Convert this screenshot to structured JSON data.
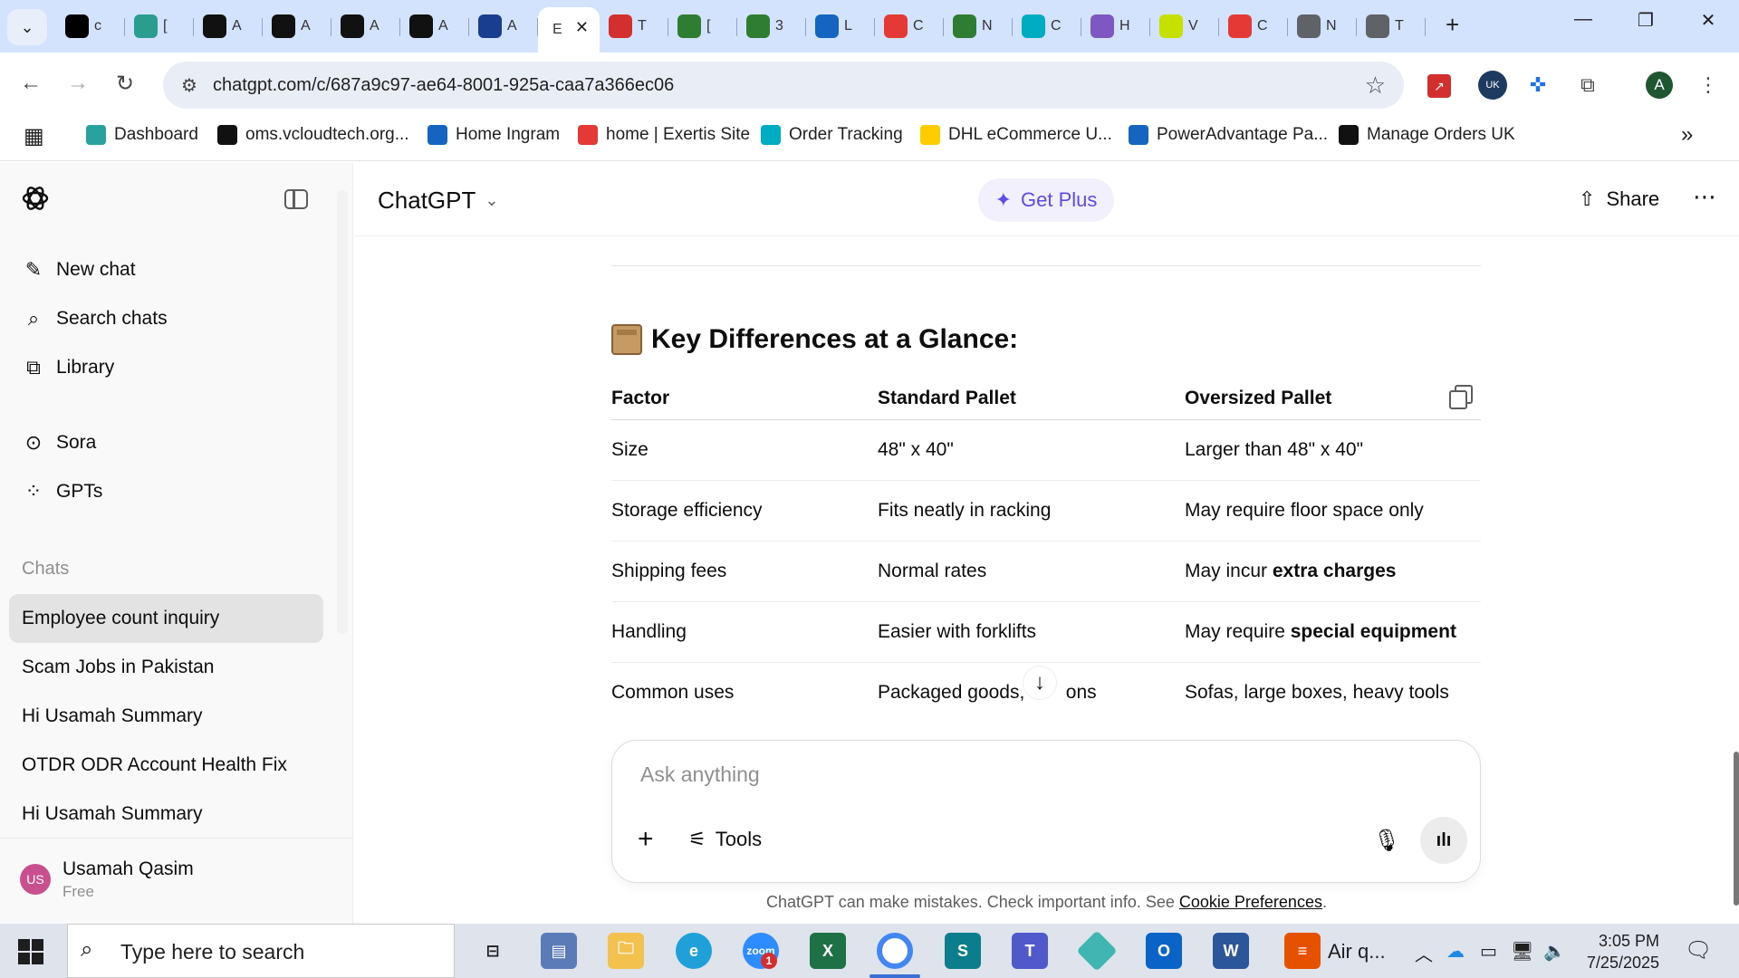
{
  "browser": {
    "tabs": [
      {
        "letter": "c",
        "icon": "oms-icon",
        "color": "#000000"
      },
      {
        "letter": "[",
        "icon": "hex-icon",
        "color": "#2a9d8f"
      },
      {
        "letter": "A",
        "icon": "amazon-icon",
        "color": "#111111"
      },
      {
        "letter": "A",
        "icon": "amazon-icon",
        "color": "#111111"
      },
      {
        "letter": "A",
        "icon": "amazon-icon",
        "color": "#111111"
      },
      {
        "letter": "A",
        "icon": "amazon-icon",
        "color": "#111111"
      },
      {
        "letter": "A",
        "icon": "play-icon",
        "color": "#1a3e8f"
      },
      {
        "letter": "E",
        "icon": "chatgpt-icon",
        "color": "#ffffff",
        "active": true
      },
      {
        "letter": "T",
        "icon": "order-tracking-icon",
        "color": "#d32f2f"
      },
      {
        "letter": "[",
        "icon": "ingram-icon",
        "color": "#2e7d32"
      },
      {
        "letter": "3",
        "icon": "ingram-icon",
        "color": "#2e7d32"
      },
      {
        "letter": "L",
        "icon": "document-icon",
        "color": "#1565c0"
      },
      {
        "letter": "C",
        "icon": "exertis-icon",
        "color": "#e53935"
      },
      {
        "letter": "N",
        "icon": "leaf-icon",
        "color": "#2e7d32"
      },
      {
        "letter": "C",
        "icon": "c-icon",
        "color": "#00acc1"
      },
      {
        "letter": "H",
        "icon": "chart-icon",
        "color": "#7e57c2"
      },
      {
        "letter": "V",
        "icon": "infos-icon",
        "color": "#c6e000"
      },
      {
        "letter": "C",
        "icon": "shwe-icon",
        "color": "#e53935"
      },
      {
        "letter": "N",
        "icon": "globe-icon",
        "color": "#5f6368"
      },
      {
        "letter": "T",
        "icon": "globe-icon",
        "color": "#5f6368"
      }
    ],
    "url": "chatgpt.com/c/687a9c97-ae64-8001-925a-caa7a366ec06",
    "profile_initial": "A",
    "bookmarks": [
      {
        "label": "Dashboard",
        "color": "#29a19c"
      },
      {
        "label": "oms.vcloudtech.org...",
        "color": "#111111"
      },
      {
        "label": "Home Ingram",
        "color": "#1565c0"
      },
      {
        "label": "home | Exertis Site",
        "color": "#e53935"
      },
      {
        "label": "Order Tracking",
        "color": "#00acc1"
      },
      {
        "label": "DHL eCommerce U...",
        "color": "#ffcc00"
      },
      {
        "label": "PowerAdvantage Pa...",
        "color": "#1565c0"
      },
      {
        "label": "Manage Orders UK",
        "color": "#111111"
      }
    ]
  },
  "sidebar": {
    "nav": [
      {
        "label": "New chat",
        "icon": "edit-icon"
      },
      {
        "label": "Search chats",
        "icon": "search-icon"
      },
      {
        "label": "Library",
        "icon": "library-icon"
      },
      {
        "label": "Sora",
        "icon": "play-circle-icon"
      },
      {
        "label": "GPTs",
        "icon": "grid-icon"
      }
    ],
    "section_label": "Chats",
    "chats": [
      {
        "label": "Employee count inquiry",
        "active": true
      },
      {
        "label": "Scam Jobs in Pakistan"
      },
      {
        "label": "Hi Usamah Summary"
      },
      {
        "label": "OTDR ODR Account Health Fix"
      },
      {
        "label": "Hi Usamah Summary"
      }
    ],
    "user": {
      "initials": "US",
      "name": "Usamah Qasim",
      "plan": "Free"
    }
  },
  "header": {
    "model": "ChatGPT",
    "get_plus": "Get Plus",
    "share": "Share"
  },
  "content": {
    "section_title": "Key Differences at a Glance:",
    "table": {
      "headers": [
        "Factor",
        "Standard Pallet",
        "Oversized Pallet"
      ],
      "rows": [
        {
          "factor": "Size",
          "standard": "48\" x 40\"",
          "oversized_pre": "Larger than 48\" x 40\"",
          "oversized_bold": ""
        },
        {
          "factor": "Storage efficiency",
          "standard": "Fits neatly in racking",
          "oversized_pre": "May require floor space only",
          "oversized_bold": ""
        },
        {
          "factor": "Shipping fees",
          "standard": "Normal rates",
          "oversized_pre": "May incur ",
          "oversized_bold": "extra charges"
        },
        {
          "factor": "Handling",
          "standard": "Easier with forklifts",
          "oversized_pre": "May require ",
          "oversized_bold": "special equipment"
        },
        {
          "factor": "Common uses",
          "standard": "Packaged goods, c     ons",
          "oversized_pre": "Sofas, large boxes, heavy tools",
          "oversized_bold": ""
        }
      ]
    }
  },
  "composer": {
    "placeholder": "Ask anything",
    "tools": "Tools",
    "disclaimer_text": "ChatGPT can make mistakes. Check important info. See ",
    "disclaimer_link": "Cookie Preferences",
    "disclaimer_end": "."
  },
  "taskbar": {
    "search_placeholder": "Type here to search",
    "app_label": "Air q...",
    "time": "3:05 PM",
    "date": "7/25/2025",
    "zoom_badge": "1"
  }
}
